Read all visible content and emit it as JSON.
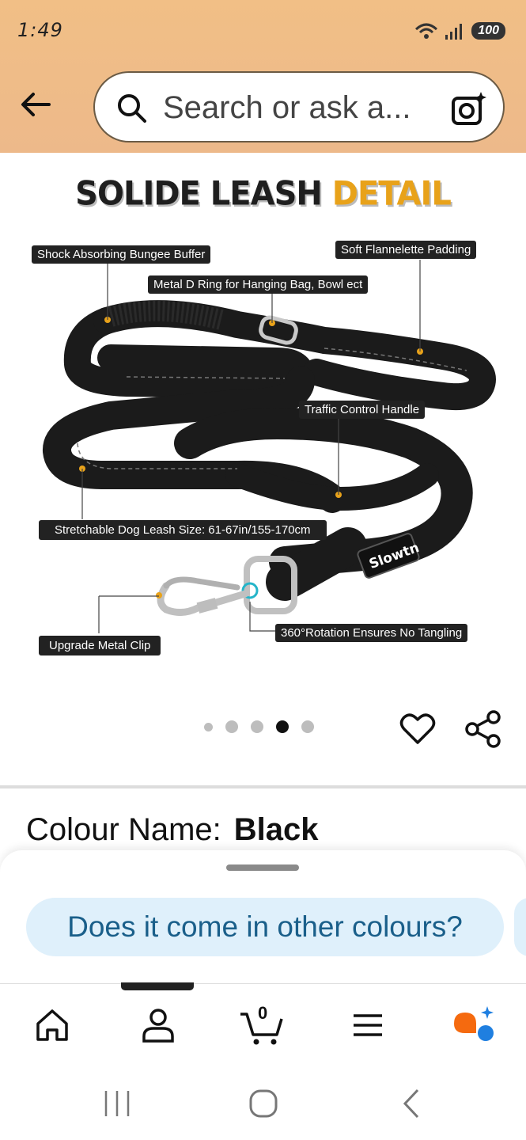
{
  "status": {
    "time": "1:49",
    "battery": "100"
  },
  "search": {
    "placeholder": "Search or ask a..."
  },
  "product_image": {
    "title_part1": "SOLIDE LEASH ",
    "title_part2": "DETAIL",
    "callouts": {
      "bungee": "Shock Absorbing Bungee Buffer",
      "padding": "Soft Flannelette Padding",
      "dring": "Metal D Ring for Hanging Bag, Bowl ect",
      "handle": "Traffic Control Handle",
      "size": "Stretchable Dog Leash Size: 61-67in/155-170cm",
      "clip": "Upgrade Metal Clip",
      "rotation": "360°Rotation Ensures No Tangling"
    },
    "brand_tag": "Slowtn",
    "dot_count": 5,
    "active_dot": 3
  },
  "colour": {
    "label": "Colour Name:",
    "value": "Black"
  },
  "suggestion": {
    "chip": "Does it come in other colours?"
  },
  "nav": {
    "cart_count": "0"
  },
  "colors": {
    "header_bg": "#f1bf86",
    "accent": "#e8a21a",
    "chip_bg": "#dff0fb",
    "chip_text": "#1a5f8a"
  }
}
